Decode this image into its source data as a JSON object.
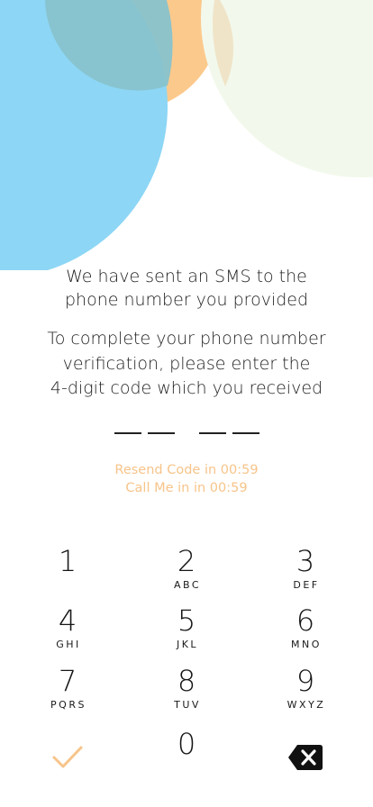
{
  "colors": {
    "blue": "#8dd6f5",
    "orange": "#fcc98c",
    "mint": "#f2f9ec",
    "accent": "#f7c48a",
    "text": "#1e1e1e"
  },
  "message": {
    "line1": "We have sent an SMS to the",
    "line2": "phone number you provided",
    "line3": "To complete your phone number",
    "line4": "verification, please enter the",
    "line5": "4-digit code which you received"
  },
  "code": {
    "digits": [
      "",
      "",
      "",
      ""
    ]
  },
  "timer": {
    "resend": "Resend Code in 00:59",
    "call": "Call Me in in 00:59"
  },
  "keypad": {
    "k1": {
      "num": "1",
      "letters": ""
    },
    "k2": {
      "num": "2",
      "letters": "ABC"
    },
    "k3": {
      "num": "3",
      "letters": "DEF"
    },
    "k4": {
      "num": "4",
      "letters": "GHI"
    },
    "k5": {
      "num": "5",
      "letters": "JKL"
    },
    "k6": {
      "num": "6",
      "letters": "MNO"
    },
    "k7": {
      "num": "7",
      "letters": "PQRS"
    },
    "k8": {
      "num": "8",
      "letters": "TUV"
    },
    "k9": {
      "num": "9",
      "letters": "WXYZ"
    },
    "k0": {
      "num": "0",
      "letters": ""
    },
    "confirm_icon": "checkmark-icon",
    "delete_icon": "backspace-icon"
  }
}
